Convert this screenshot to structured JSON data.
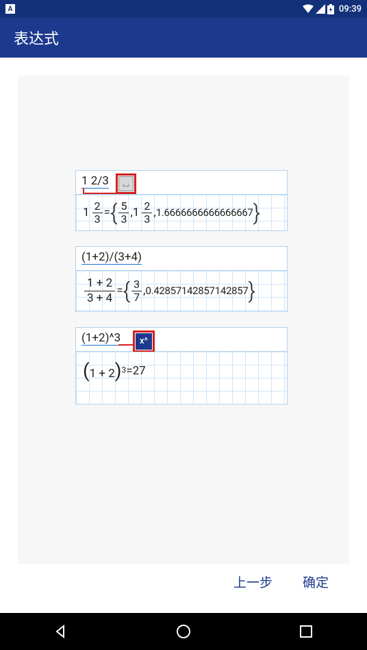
{
  "status": {
    "time": "09:39",
    "app_indicator": "A"
  },
  "appbar": {
    "title": "表达式"
  },
  "examples": [
    {
      "input": "1 2/3",
      "key": "space",
      "output": {
        "mixed_whole": "1",
        "mixed_num": "2",
        "mixed_den": "3",
        "eq": " = ",
        "set_a_num": "5",
        "set_a_den": "3",
        "set_b_whole": "1",
        "set_b_num": "2",
        "set_b_den": "3",
        "decimal": "1.6666666666666667"
      }
    },
    {
      "input": "(1+2)/(3+4)",
      "output": {
        "top": "1 + 2",
        "bot": "3 + 4",
        "eq": " = ",
        "set_a_num": "3",
        "set_a_den": "7",
        "decimal": "0.42857142857142857"
      }
    },
    {
      "input": "(1+2)^3",
      "key": "x^",
      "output": {
        "base": "1 + 2",
        "exp": "3",
        "eq": " = ",
        "result": "27"
      }
    }
  ],
  "buttons": {
    "prev": "上一步",
    "ok": "确定"
  }
}
